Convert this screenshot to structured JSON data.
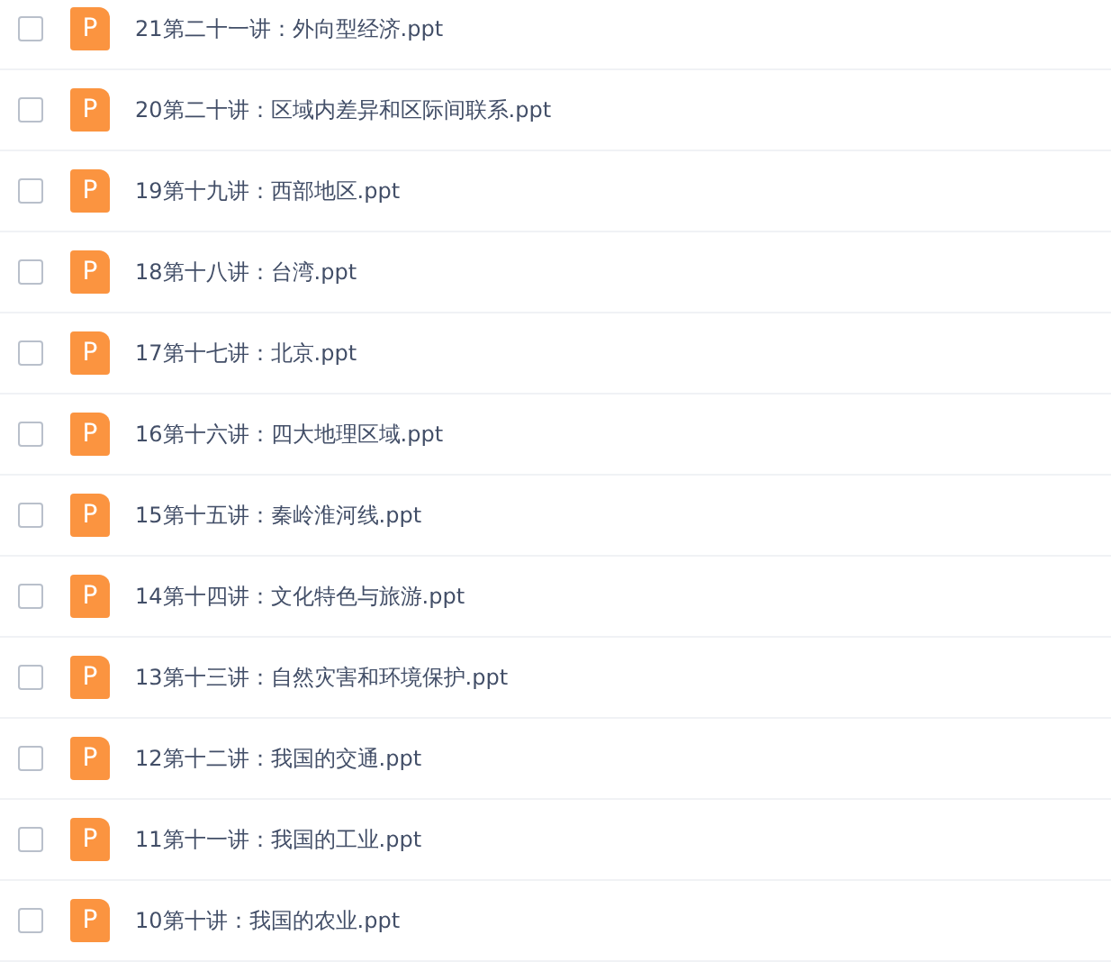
{
  "files": [
    {
      "name": "21第二十一讲：外向型经济.ppt",
      "icon_letter": "P",
      "checked": false
    },
    {
      "name": "20第二十讲：区域内差异和区际间联系.ppt",
      "icon_letter": "P",
      "checked": false
    },
    {
      "name": "19第十九讲：西部地区.ppt",
      "icon_letter": "P",
      "checked": false
    },
    {
      "name": "18第十八讲：台湾.ppt",
      "icon_letter": "P",
      "checked": false
    },
    {
      "name": "17第十七讲：北京.ppt",
      "icon_letter": "P",
      "checked": false
    },
    {
      "name": "16第十六讲：四大地理区域.ppt",
      "icon_letter": "P",
      "checked": false
    },
    {
      "name": "15第十五讲：秦岭淮河线.ppt",
      "icon_letter": "P",
      "checked": false
    },
    {
      "name": "14第十四讲：文化特色与旅游.ppt",
      "icon_letter": "P",
      "checked": false
    },
    {
      "name": "13第十三讲：自然灾害和环境保护.ppt",
      "icon_letter": "P",
      "checked": false
    },
    {
      "name": "12第十二讲：我国的交通.ppt",
      "icon_letter": "P",
      "checked": false
    },
    {
      "name": "11第十一讲：我国的工业.ppt",
      "icon_letter": "P",
      "checked": false
    },
    {
      "name": "10第十讲：我国的农业.ppt",
      "icon_letter": "P",
      "checked": false
    }
  ]
}
